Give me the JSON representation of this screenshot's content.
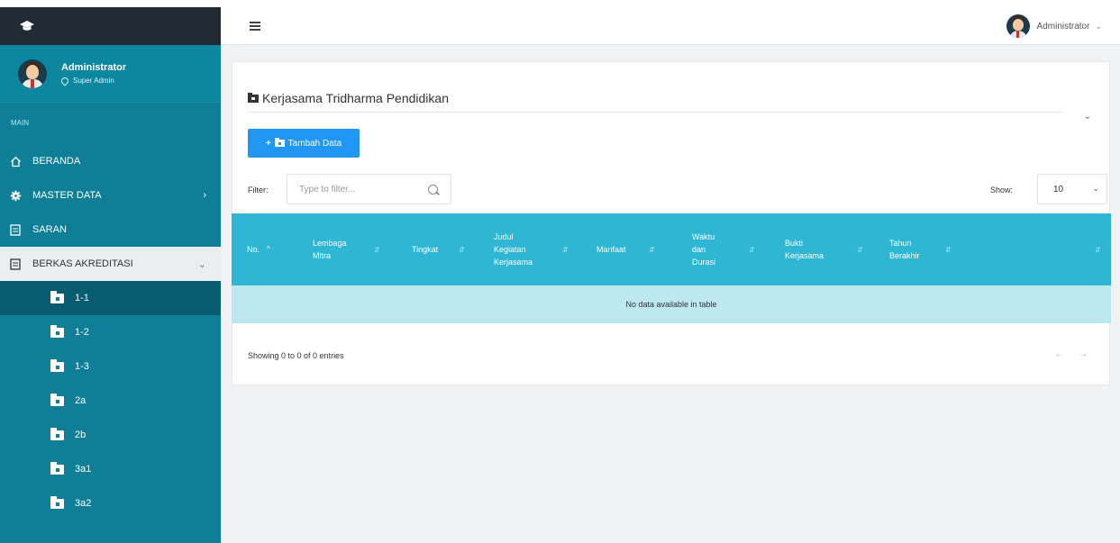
{
  "brand": {
    "icon": "graduation-cap-icon"
  },
  "profile": {
    "name": "Administrator",
    "role": "Super Admin"
  },
  "sidebar": {
    "section_label": "MAIN",
    "items": [
      {
        "label": "BERANDA",
        "icon": "home-icon"
      },
      {
        "label": "MASTER DATA",
        "icon": "gear-icon",
        "arrow": "›"
      },
      {
        "label": "SARAN",
        "icon": "document-icon"
      },
      {
        "label": "BERKAS AKREDITASI",
        "icon": "file-icon",
        "arrow": "⌄"
      }
    ],
    "sub_items": [
      "1-1",
      "1-2",
      "1-3",
      "2a",
      "2b",
      "3a1",
      "3a2"
    ]
  },
  "topbar": {
    "user_name": "Administrator",
    "caret": "⌄"
  },
  "panel": {
    "title": "Kerjasama Tridharma Pendidikan",
    "collapse": "⌄",
    "add_button": "Tambah Data",
    "add_plus": "+",
    "filter_label": "Filter:",
    "filter_placeholder": "Type to filter...",
    "show_label": "Show:",
    "show_value": "10",
    "show_caret": "⌄"
  },
  "table": {
    "headers": [
      {
        "lines": [
          "No."
        ],
        "sort": "^"
      },
      {
        "lines": [
          "Lembaga",
          "Mitra"
        ],
        "sort": "⇵"
      },
      {
        "lines": [
          "Tingkat"
        ],
        "sort": "⇵"
      },
      {
        "lines": [
          "Judul",
          "Kegiatan",
          "Kerjasama"
        ],
        "sort": "⇵"
      },
      {
        "lines": [
          "Manfaat"
        ],
        "sort": "⇵"
      },
      {
        "lines": [
          "Waktu",
          "dan",
          "Durasi"
        ],
        "sort": "⇵"
      },
      {
        "lines": [
          "Bukti",
          "Kerjasama"
        ],
        "sort": "⇵"
      },
      {
        "lines": [
          "Tahun",
          "Berakhir"
        ],
        "sort": "⇵"
      },
      {
        "lines": [
          ""
        ],
        "sort": "⇵"
      }
    ],
    "empty_message": "No data available in table",
    "showing": "Showing 0 to 0 of 0 entries",
    "prev": "←",
    "next": "→"
  }
}
